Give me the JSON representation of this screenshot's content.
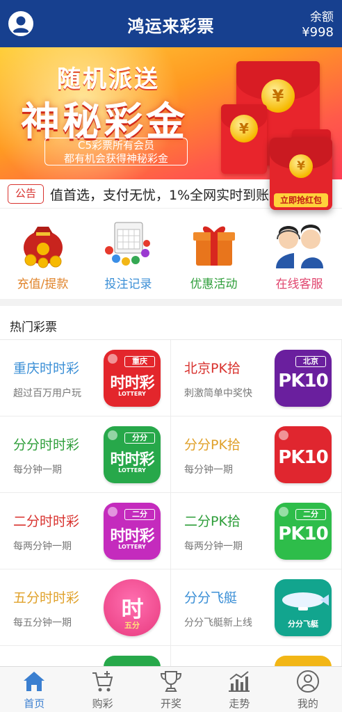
{
  "header": {
    "title": "鸿运来彩票",
    "balance_label": "余额",
    "balance_value": "¥998"
  },
  "banner": {
    "line1": "随机派送",
    "line2": "神秘彩金",
    "box_line1": "C5彩票所有会员",
    "box_line2": "都有机会获得神秘彩金",
    "coin_symbol": "¥",
    "slide_count": 9,
    "active_slide": 5
  },
  "red_packet": {
    "symbol": "¥",
    "button": "立即抢红包"
  },
  "notice": {
    "badge": "公告",
    "text": "值首选，支付无忧，1%全网实时到账 原票"
  },
  "quick_menu": [
    {
      "label": "充值/提款",
      "color": "#e0832a",
      "icon": "money-bag-icon"
    },
    {
      "label": "投注记录",
      "color": "#3b8fd6",
      "icon": "bingo-icon"
    },
    {
      "label": "优惠活动",
      "color": "#2e9e3a",
      "icon": "gift-icon"
    },
    {
      "label": "在线客服",
      "color": "#e0456e",
      "icon": "customer-service-icon"
    }
  ],
  "hot": {
    "title": "热门彩票",
    "items": [
      {
        "name": "重庆时时彩",
        "name_color": "#3b8fd6",
        "desc": "超过百万用户玩",
        "logo_tag": "重庆",
        "logo_main": "时时彩",
        "logo_sub": "LOTTERY",
        "logo_color": "#e3262c"
      },
      {
        "name": "北京PK拾",
        "name_color": "#d8322e",
        "desc": "刺激简单中奖快",
        "logo_tag": "北京",
        "logo_main": "PK10",
        "logo_sub": "",
        "logo_color": "#6a1f9e"
      },
      {
        "name": "分分时时彩",
        "name_color": "#2e9e3a",
        "desc": "每分钟一期",
        "logo_tag": "分分",
        "logo_main": "时时彩",
        "logo_sub": "LOTTERY",
        "logo_color": "#27a84a"
      },
      {
        "name": "分分PK拾",
        "name_color": "#e0a12a",
        "desc": "每分钟一期",
        "logo_tag": "",
        "logo_main": "PK10",
        "logo_sub": "",
        "logo_color": "#e0262f"
      },
      {
        "name": "二分时时彩",
        "name_color": "#d8322e",
        "desc": "每两分钟一期",
        "logo_tag": "二分",
        "logo_main": "时时彩",
        "logo_sub": "LOTTERY",
        "logo_color": "#c42bbd"
      },
      {
        "name": "二分PK拾",
        "name_color": "#2e9e3a",
        "desc": "每两分钟一期",
        "logo_tag": "二分",
        "logo_main": "PK10",
        "logo_sub": "",
        "logo_color": "#2ebd4a"
      },
      {
        "name": "五分时时彩",
        "name_color": "#e0a12a",
        "desc": "每五分钟一期",
        "logo_tag": "",
        "logo_main": "时",
        "logo_sub": "五分",
        "logo_color": "#f0408a"
      },
      {
        "name": "分分飞艇",
        "name_color": "#3b8fd6",
        "desc": "分分飞艇新上线",
        "logo_tag": "",
        "logo_main": "分分飞艇",
        "logo_sub": "",
        "logo_color": "#12a58e"
      }
    ]
  },
  "bottom_nav": [
    {
      "label": "首页",
      "icon": "home-icon",
      "active": true
    },
    {
      "label": "购彩",
      "icon": "cart-icon",
      "active": false
    },
    {
      "label": "开奖",
      "icon": "trophy-icon",
      "active": false
    },
    {
      "label": "走势",
      "icon": "trend-chart-icon",
      "active": false
    },
    {
      "label": "我的",
      "icon": "user-icon",
      "active": false
    }
  ]
}
